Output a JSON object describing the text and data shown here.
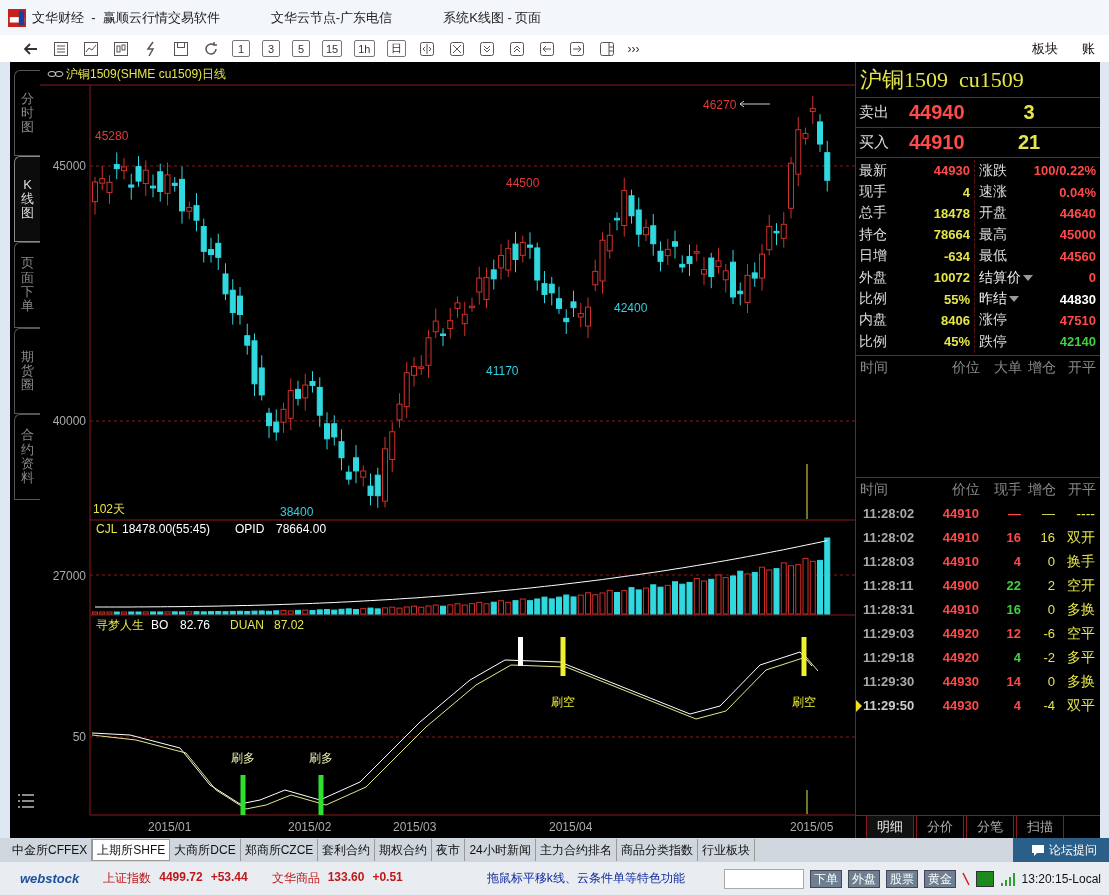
{
  "window": {
    "title": "文华财经  -  赢顺云行情交易软件",
    "node": "文华云节点-广东电信",
    "page": "系统K线图 - 页面"
  },
  "toolbar": {
    "period_buttons": [
      "1",
      "3",
      "5",
      "15",
      "1h",
      "日"
    ],
    "more": "›››",
    "menus": [
      "板块",
      "账"
    ]
  },
  "side_tabs": [
    {
      "label": "分时图",
      "selected": false
    },
    {
      "label": "K线图",
      "selected": true
    },
    {
      "label": "页面下单",
      "selected": false
    },
    {
      "label": "期货圈",
      "selected": false
    },
    {
      "label": "合约资料",
      "selected": false
    }
  ],
  "chart": {
    "title": "沪铜1509(SHME cu1509)日线",
    "price_axis": [
      "45000",
      "40000"
    ],
    "price_labels": [
      {
        "text": "45280",
        "kind": "high"
      },
      {
        "text": "46270",
        "kind": "high"
      },
      {
        "text": "44500",
        "kind": "high"
      },
      {
        "text": "41170",
        "kind": "low"
      },
      {
        "text": "42400",
        "kind": "low"
      },
      {
        "text": "38400",
        "kind": "low"
      }
    ],
    "days": "102天",
    "volume_legend": [
      "CJL",
      "18478.00(55:45)",
      "OPID",
      "78664.00"
    ],
    "volume_axis": "27000",
    "indicator_legend": [
      "寻梦人生",
      "BO",
      "82.76",
      "DUAN",
      "87.02"
    ],
    "indicator_axis": "50",
    "signals": [
      {
        "label": "刷多",
        "kind": "long"
      },
      {
        "label": "刷多",
        "kind": "long"
      },
      {
        "label": "刷空",
        "kind": "short"
      },
      {
        "label": "刷空",
        "kind": "short"
      }
    ],
    "dates": [
      "2015/01",
      "2015/02",
      "2015/03",
      "2015/04",
      "2015/05"
    ]
  },
  "quote": {
    "name": "沪铜1509",
    "code": "cu1509",
    "ask": {
      "label": "卖出",
      "price": "44940",
      "volume": "3"
    },
    "bid": {
      "label": "买入",
      "price": "44910",
      "volume": "21"
    },
    "stats": [
      {
        "label": "最新",
        "value": "44930",
        "color": "#ff4a4a",
        "dropdown": false
      },
      {
        "label": "涨跌",
        "value": "100/0.22%",
        "color": "#ff4a4a",
        "dropdown": false
      },
      {
        "label": "现手",
        "value": "4",
        "color": "#e6e64a",
        "dropdown": false
      },
      {
        "label": "速涨",
        "value": "0.04%",
        "color": "#ff4a4a",
        "dropdown": false
      },
      {
        "label": "总手",
        "value": "18478",
        "color": "#e6e64a",
        "dropdown": false
      },
      {
        "label": "开盘",
        "value": "44640",
        "color": "#ff4a4a",
        "dropdown": false
      },
      {
        "label": "持仓",
        "value": "78664",
        "color": "#e6e64a",
        "dropdown": false
      },
      {
        "label": "最高",
        "value": "45000",
        "color": "#ff4a4a",
        "dropdown": false
      },
      {
        "label": "日增",
        "value": "-634",
        "color": "#e6e64a",
        "dropdown": false
      },
      {
        "label": "最低",
        "value": "44560",
        "color": "#ff4a4a",
        "dropdown": false
      },
      {
        "label": "外盘",
        "value": "10072",
        "color": "#e6e64a",
        "dropdown": false
      },
      {
        "label": "结算价",
        "value": "0",
        "color": "#ff4a4a",
        "dropdown": true
      },
      {
        "label": "比例",
        "value": "55%",
        "color": "#e6e64a",
        "dropdown": false
      },
      {
        "label": "昨结",
        "value": "44830",
        "color": "#ffffff",
        "dropdown": true
      },
      {
        "label": "内盘",
        "value": "8406",
        "color": "#e6e64a",
        "dropdown": false
      },
      {
        "label": "涨停",
        "value": "47510",
        "color": "#ff4a4a",
        "dropdown": false
      },
      {
        "label": "比例",
        "value": "45%",
        "color": "#e6e64a",
        "dropdown": false
      },
      {
        "label": "跌停",
        "value": "42140",
        "color": "#40d040",
        "dropdown": false
      }
    ],
    "detail_columns": [
      "时间",
      "价位",
      "大单",
      "增仓",
      "开平"
    ]
  },
  "ticks": {
    "columns": [
      "时间",
      "价位",
      "现手",
      "增仓",
      "开平"
    ],
    "rows": [
      {
        "time": "11:28:02",
        "price": "44910",
        "volume": "—",
        "color": "#ff4a4a",
        "change": "—",
        "type": "----",
        "selected": false
      },
      {
        "time": "11:28:02",
        "price": "44910",
        "volume": "16",
        "color": "#ff4a4a",
        "change": "16",
        "type": "双开",
        "selected": false
      },
      {
        "time": "11:28:03",
        "price": "44910",
        "volume": "4",
        "color": "#ff4a4a",
        "change": "0",
        "type": "换手",
        "selected": false
      },
      {
        "time": "11:28:11",
        "price": "44900",
        "volume": "22",
        "color": "#40d040",
        "change": "2",
        "type": "空开",
        "selected": false
      },
      {
        "time": "11:28:31",
        "price": "44910",
        "volume": "16",
        "color": "#40d040",
        "change": "0",
        "type": "多换",
        "selected": false
      },
      {
        "time": "11:29:03",
        "price": "44920",
        "volume": "12",
        "color": "#ff4a4a",
        "change": "-6",
        "type": "空平",
        "selected": false
      },
      {
        "time": "11:29:18",
        "price": "44920",
        "volume": "4",
        "color": "#40d040",
        "change": "-2",
        "type": "多平",
        "selected": false
      },
      {
        "time": "11:29:30",
        "price": "44930",
        "volume": "14",
        "color": "#ff4a4a",
        "change": "0",
        "type": "多换",
        "selected": false
      },
      {
        "time": "11:29:50",
        "price": "44930",
        "volume": "4",
        "color": "#ff4a4a",
        "change": "-4",
        "type": "双平",
        "selected": true
      }
    ]
  },
  "panel_tabs": [
    {
      "label": "明细",
      "selected": true
    },
    {
      "label": "分价",
      "selected": false
    },
    {
      "label": "分笔",
      "selected": false
    },
    {
      "label": "扫描",
      "selected": false
    }
  ],
  "exchange_tabs": [
    {
      "label": "中金所CFFEX",
      "selected": false
    },
    {
      "label": "上期所SHFE",
      "selected": true
    },
    {
      "label": "大商所DCE",
      "selected": false
    },
    {
      "label": "郑商所CZCE",
      "selected": false
    },
    {
      "label": "套利合约",
      "selected": false
    },
    {
      "label": "期权合约",
      "selected": false
    },
    {
      "label": "夜市",
      "selected": false
    },
    {
      "label": "24小时新闻",
      "selected": false
    },
    {
      "label": "主力合约排名",
      "selected": false
    },
    {
      "label": "商品分类指数",
      "selected": false
    },
    {
      "label": "行业板块",
      "selected": false
    }
  ],
  "forum_button": "论坛提问",
  "status": {
    "logo": "webstock",
    "indices": [
      {
        "name": "上证指数",
        "value": "4499.72",
        "change": "+53.44"
      },
      {
        "name": "文华商品",
        "value": "133.60",
        "change": "+0.51"
      }
    ],
    "ticker": "拖鼠标平移k线、云条件单等特色功能",
    "buttons": [
      "下单",
      "外盘",
      "股票",
      "黄金"
    ],
    "clock": "13:20:15-Local"
  }
}
